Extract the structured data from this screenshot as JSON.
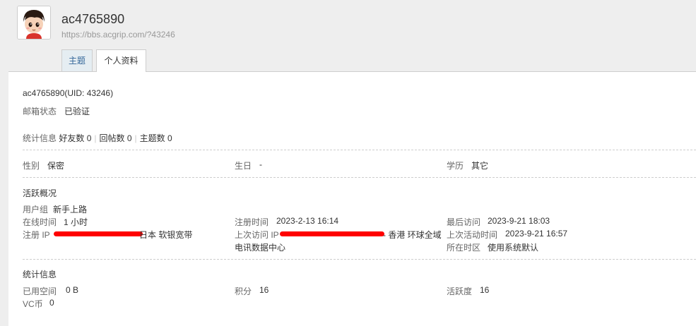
{
  "header": {
    "username": "ac4765890",
    "url": "https://bbs.acgrip.com/?43246"
  },
  "tabs": [
    {
      "label": "主题"
    },
    {
      "label": "个人资料"
    }
  ],
  "profile": {
    "name_uid": "ac4765890(UID: 43246)",
    "email_label": "邮箱状态",
    "email_value": "已验证",
    "stats_label": "统计信息",
    "friends": "好友数 0",
    "replies": "回帖数 0",
    "threads": "主题数 0",
    "gender_label": "性别",
    "gender_value": "保密",
    "birthday_label": "生日",
    "birthday_value": "-",
    "education_label": "学历",
    "education_value": "其它"
  },
  "activity": {
    "title": "活跃概况",
    "usergroup_label": "用户组",
    "usergroup_value": "新手上路",
    "online_label": "在线时间",
    "online_value": "1 小时",
    "regip_label": "注册 IP",
    "regip_suffix": "日本 软银宽带",
    "regtime_label": "注册时间",
    "regtime_value": "2023-2-13 16:14",
    "lastip_label": "上次访问 IP",
    "lastip_suffix": "- 香港 环球全域",
    "lastip_suffix2": "电讯数据中心",
    "lastvisit_label": "最后访问",
    "lastvisit_value": "2023-9-21 18:03",
    "lastactive_label": "上次活动时间",
    "lastactive_value": "2023-9-21 16:57",
    "timezone_label": "所在时区",
    "timezone_value": "使用系统默认"
  },
  "statistics": {
    "title": "统计信息",
    "space_label": "已用空间",
    "space_value": "0 B",
    "points_label": "积分",
    "points_value": "16",
    "activity_label": "活跃度",
    "activity_value": "16",
    "vc_label": "VC币",
    "vc_value": "0"
  },
  "colors": {
    "tab_active_bg": "#ffffff",
    "tab_inactive_bg": "#e5edf2",
    "link": "#336699",
    "redaction": "#ff0000"
  },
  "icons": {
    "avatar": "cartoon-boy-avatar"
  }
}
